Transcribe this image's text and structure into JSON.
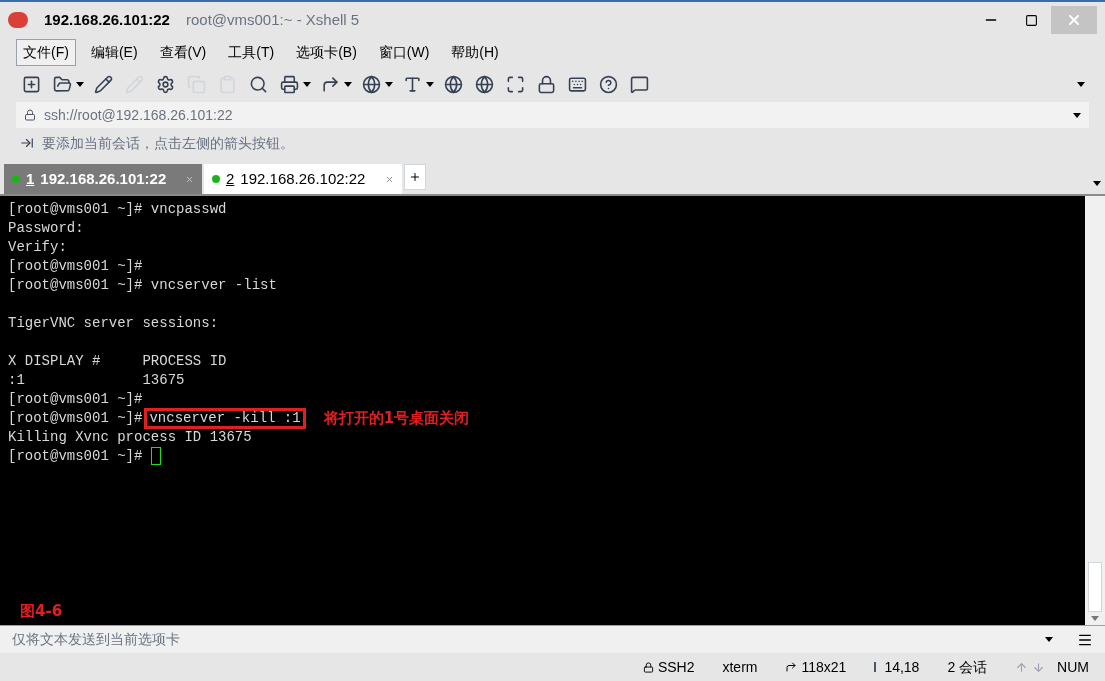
{
  "window": {
    "title": "192.168.26.101:22",
    "subtitle": "root@vms001:~ - Xshell 5"
  },
  "menu": [
    {
      "label": "文件(F)",
      "selected": true
    },
    {
      "label": "编辑(E)",
      "selected": false
    },
    {
      "label": "查看(V)",
      "selected": false
    },
    {
      "label": "工具(T)",
      "selected": false
    },
    {
      "label": "选项卡(B)",
      "selected": false
    },
    {
      "label": "窗口(W)",
      "selected": false
    },
    {
      "label": "帮助(H)",
      "selected": false
    }
  ],
  "address": {
    "value": "ssh://root@192.168.26.101:22"
  },
  "hint": "要添加当前会话，点击左侧的箭头按钮。",
  "tabs": [
    {
      "index": "1",
      "label": "192.168.26.101:22",
      "selected": true,
      "connected": true
    },
    {
      "index": "2",
      "label": "192.168.26.102:22",
      "selected": false,
      "connected": true
    }
  ],
  "terminal": {
    "lines": [
      {
        "kind": "text",
        "text": "[root@vms001 ~]# vncpasswd"
      },
      {
        "kind": "text",
        "text": "Password:"
      },
      {
        "kind": "text",
        "text": "Verify:"
      },
      {
        "kind": "text",
        "text": "[root@vms001 ~]#"
      },
      {
        "kind": "text",
        "text": "[root@vms001 ~]# vncserver -list"
      },
      {
        "kind": "blank"
      },
      {
        "kind": "text",
        "text": "TigerVNC server sessions:"
      },
      {
        "kind": "blank"
      },
      {
        "kind": "text",
        "text": "X DISPLAY #     PROCESS ID"
      },
      {
        "kind": "text",
        "text": ":1              13675"
      },
      {
        "kind": "text",
        "text": "[root@vms001 ~]#"
      },
      {
        "kind": "boxed",
        "text": "[root@vms001 ~]#",
        "command": "vncserver -kill :1",
        "note": "将打开的1号桌面关闭"
      },
      {
        "kind": "text",
        "text": "Killing Xvnc process ID 13675"
      },
      {
        "kind": "cursor",
        "text": "[root@vms001 ~]# "
      }
    ],
    "figure_label": "图4-6"
  },
  "send_bar": {
    "placeholder": "仅将文本发送到当前选项卡"
  },
  "status": [
    {
      "kind": "lock",
      "text": "SSH2"
    },
    {
      "kind": "plain",
      "text": "xterm"
    },
    {
      "kind": "size",
      "text": "118x21"
    },
    {
      "kind": "pos",
      "text": "14,18"
    },
    {
      "kind": "plain",
      "text": "2 会话"
    },
    {
      "kind": "arrows",
      "text": "NUM"
    }
  ]
}
